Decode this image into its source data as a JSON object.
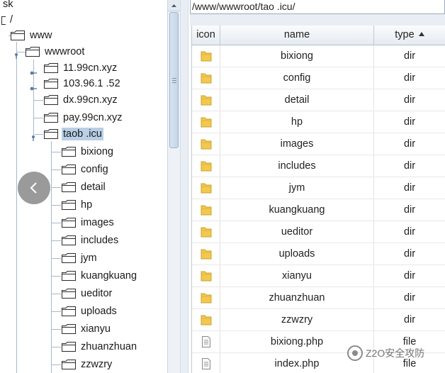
{
  "tree": {
    "top_partial": "sk",
    "root": "/",
    "www": "www",
    "wwwroot": "wwwroot",
    "sites": [
      {
        "label": "11.99cn.xyz",
        "selected": false
      },
      {
        "label": "103.96.1 .52",
        "selected": false
      },
      {
        "label": "dx.99cn.xyz",
        "selected": false
      },
      {
        "label": "pay.99cn.xyz",
        "selected": false
      },
      {
        "label": "taob .icu",
        "selected": true
      }
    ],
    "children": [
      "bixiong",
      "config",
      "detail",
      "hp",
      "images",
      "includes",
      "jym",
      "kuangkuang",
      "ueditor",
      "uploads",
      "xianyu",
      "zhuanzhuan",
      "zzwzry"
    ]
  },
  "path": {
    "value": "/www/wwwroot/tao .icu/"
  },
  "table": {
    "headers": {
      "icon": "icon",
      "name": "name",
      "type": "type"
    },
    "sort": {
      "column": "type",
      "direction": "ascending"
    },
    "rows": [
      {
        "name": "bixiong",
        "type": "dir",
        "icon": "folder-icon"
      },
      {
        "name": "config",
        "type": "dir",
        "icon": "folder-icon"
      },
      {
        "name": "detail",
        "type": "dir",
        "icon": "folder-icon"
      },
      {
        "name": "hp",
        "type": "dir",
        "icon": "folder-icon"
      },
      {
        "name": "images",
        "type": "dir",
        "icon": "folder-icon"
      },
      {
        "name": "includes",
        "type": "dir",
        "icon": "folder-icon"
      },
      {
        "name": "jym",
        "type": "dir",
        "icon": "folder-icon"
      },
      {
        "name": "kuangkuang",
        "type": "dir",
        "icon": "folder-icon"
      },
      {
        "name": "ueditor",
        "type": "dir",
        "icon": "folder-icon"
      },
      {
        "name": "uploads",
        "type": "dir",
        "icon": "folder-icon"
      },
      {
        "name": "xianyu",
        "type": "dir",
        "icon": "folder-icon"
      },
      {
        "name": "zhuanzhuan",
        "type": "dir",
        "icon": "folder-icon"
      },
      {
        "name": "zzwzry",
        "type": "dir",
        "icon": "folder-icon"
      },
      {
        "name": "bixiong.php",
        "type": "file",
        "icon": "file-icon"
      },
      {
        "name": "index.php",
        "type": "file",
        "icon": "file-icon"
      }
    ]
  },
  "watermark": {
    "text": "Z2O安全攻防"
  },
  "colors": {
    "selection": "#b8cfe5",
    "folder": "#f2c94c",
    "tree_line": "#a6b8cc"
  }
}
